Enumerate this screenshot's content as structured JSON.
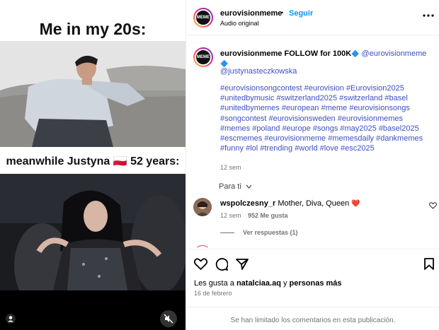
{
  "media": {
    "top_caption": "Me in my 20s:",
    "mid_caption": "meanwhile Justyna 🇵🇱 52 years:"
  },
  "header": {
    "username": "eurovisionmeme",
    "separator": "•",
    "follow": "Seguir",
    "audio": "Audio original",
    "avatar_text": "MEME",
    "more": "•••"
  },
  "caption": {
    "username": "eurovisionmeme",
    "lead": "FOLLOW for 100K",
    "lead_emoji": "🔷",
    "mention1": "@eurovisionmeme",
    "mention1_emoji": "🔷",
    "mention2": "@justynasteczkowska",
    "hashtags": "#eurovisionsongcontest #eurovision #Eurovision2025 #unitedbymusic #switzerland2025 #switzerland #basel #unitedbymemes #european #meme #eurovisionsongs #songcontest #eurovisionsweden #eurovisionmemes #memes #poland #europe #songs #may2025 #basel2025 #escmemes #eurovisionmeme #memesdaily #dankmemes #funny #lol #trending #world #love #esc2025",
    "time": "12 sem"
  },
  "filter": {
    "label": "Para ti",
    "chevron": "⌄"
  },
  "comment": {
    "username": "wspolczesny_r",
    "text": "Mother, Diva, Queen",
    "emoji": "❤️",
    "time": "12 sem",
    "likes": "952 Me gusta",
    "replies": "Ver respuestas (1)"
  },
  "likes": {
    "prefix": "Les gusta a",
    "user": "natalciaa.aq",
    "middle": "y",
    "others": "personas más",
    "date": "16 de febrero"
  },
  "footer": {
    "limited": "Se han limitado los comentarios en esta publicación."
  },
  "colors": {
    "accent": "#0095f6",
    "hashtag": "#3d4fc4",
    "heart": "#ff3040"
  }
}
